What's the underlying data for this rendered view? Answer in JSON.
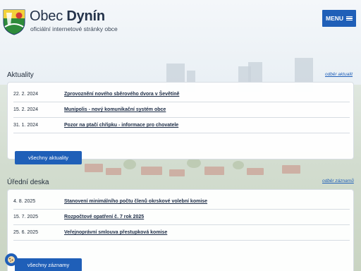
{
  "header": {
    "title_light": "Obec",
    "title_bold": "Dynín",
    "subtitle": "oficiální internetové stránky obce",
    "menu_label": "MENU"
  },
  "news": {
    "heading": "Aktuality",
    "subscribe_link": "odběr aktualit",
    "items": [
      {
        "date": "22. 2. 2024",
        "text": "Zprovoznění nového sběrového dvora v Ševětíně"
      },
      {
        "date": "15. 2. 2024",
        "text": "Munipolis - nový komunikační systém obce"
      },
      {
        "date": "31. 1. 2024",
        "text": "Pozor na ptačí chřipku - informace pro chovatele"
      }
    ],
    "all_button": "všechny aktuality"
  },
  "board": {
    "heading": "Úřední deska",
    "subscribe_link": "odběr záznamů",
    "items": [
      {
        "date": "4. 8. 2025",
        "text": "Stanovení minimálního počtu členů okrskové volební komise"
      },
      {
        "date": "15. 7. 2025",
        "text": "Rozpočtové opatření č. 7 rok 2025"
      },
      {
        "date": "25. 6. 2025",
        "text": "Veřejnoprávní smlouva přestupková komise"
      }
    ],
    "all_button": "všechny záznamy"
  },
  "icons": {
    "crest": "coat-of-arms-icon",
    "menu": "hamburger-icon",
    "cookie": "cookie-icon"
  },
  "colors": {
    "accent": "#1f5fb8",
    "text": "#1f2b3a"
  }
}
